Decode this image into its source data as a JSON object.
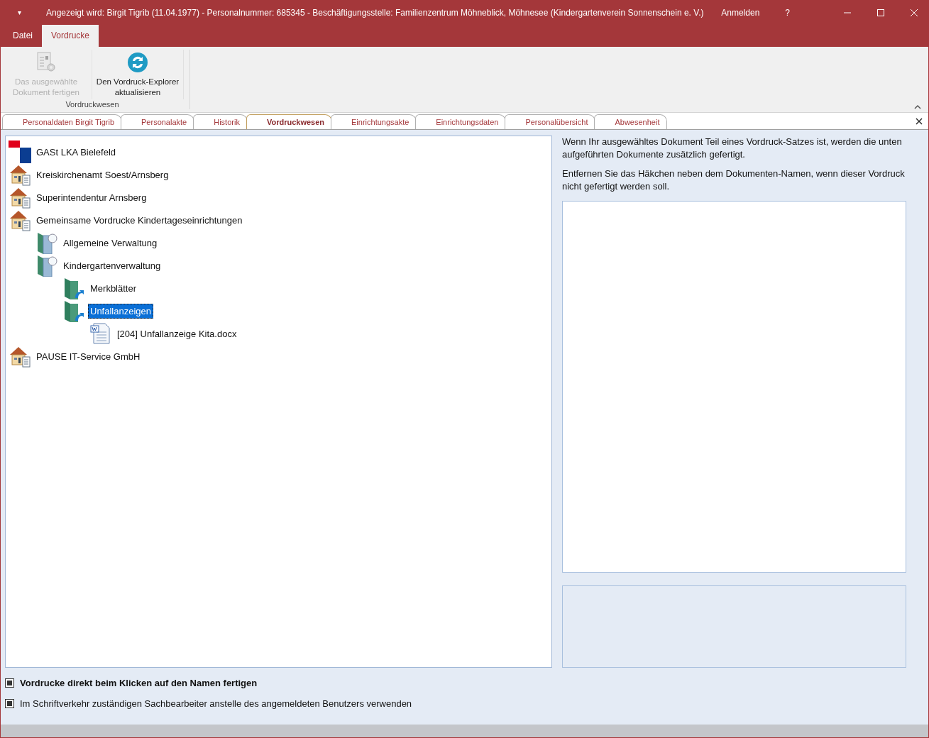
{
  "window": {
    "title": "Angezeigt wird: Birgit Tigrib (11.04.1977) - Personalnummer: 685345 - Beschäftigungsstelle: Familienzentrum Möhneblick, Möhnesee (Kindergartenverein Sonnenschein e. V.)",
    "quick_access": "▾",
    "login": "Anmelden",
    "help": "?"
  },
  "ribbon_tabs": [
    {
      "label": "Datei",
      "selected": false
    },
    {
      "label": "Vordrucke",
      "selected": true
    }
  ],
  "ribbon": {
    "group_label": "Vordruckwesen",
    "buttons": [
      {
        "label": "Das ausgewählte Dokument fertigen",
        "kind": "generate",
        "disabled": true
      },
      {
        "label": "Den Vordruck-Explorer aktualisieren",
        "kind": "refresh",
        "disabled": false
      }
    ]
  },
  "document_tabs": [
    {
      "label": "Personaldaten Birgit Tigrib",
      "selected": false
    },
    {
      "label": "Personalakte",
      "selected": false
    },
    {
      "label": "Historik",
      "selected": false
    },
    {
      "label": "Vordruckwesen",
      "selected": true
    },
    {
      "label": "Einrichtungsakte",
      "selected": false
    },
    {
      "label": "Einrichtungsdaten",
      "selected": false
    },
    {
      "label": "Personalübersicht",
      "selected": false
    },
    {
      "label": "Abwesenheit",
      "selected": false
    }
  ],
  "tree": [
    {
      "label": "GASt LKA Bielefeld",
      "kind": "logo",
      "selected": false
    },
    {
      "label": "Kreiskirchenamt Soest/Arnsberg",
      "kind": "house",
      "selected": false
    },
    {
      "label": "Superintendentur Arnsberg",
      "kind": "house",
      "selected": false
    },
    {
      "label": "Gemeinsame Vordrucke Kindertageseinrichtungen",
      "kind": "house",
      "selected": false,
      "children": [
        {
          "label": "Allgemeine Verwaltung",
          "kind": "binder",
          "selected": false
        },
        {
          "label": "Kindergartenverwaltung",
          "kind": "binder",
          "selected": false,
          "children": [
            {
              "label": "Merkblätter",
              "kind": "folder",
              "selected": false
            },
            {
              "label": "Unfallanzeigen",
              "kind": "folder",
              "selected": true,
              "children": [
                {
                  "label": "[204] Unfallanzeige Kita.docx",
                  "kind": "document",
                  "selected": false
                }
              ]
            }
          ]
        }
      ]
    },
    {
      "label": "PAUSE IT-Service GmbH",
      "kind": "house",
      "selected": false
    }
  ],
  "info": [
    "Wenn Ihr ausgewähltes Dokument Teil eines Vordruck-Satzes ist, werden die unten aufgeführten Dokumente zusätzlich gefertigt.",
    "Entfernen Sie das Häkchen neben dem Dokumenten-Namen, wenn dieser Vordruck nicht gefertigt werden soll."
  ],
  "options": [
    {
      "label": "Vordrucke direkt beim Klicken auf den Namen fertigen",
      "checked": true,
      "emphasized": true
    },
    {
      "label": "Im Schriftverkehr zuständigen Sachbearbeiter anstelle des angemeldeten Benutzers verwenden",
      "checked": true,
      "emphasized": false
    }
  ]
}
